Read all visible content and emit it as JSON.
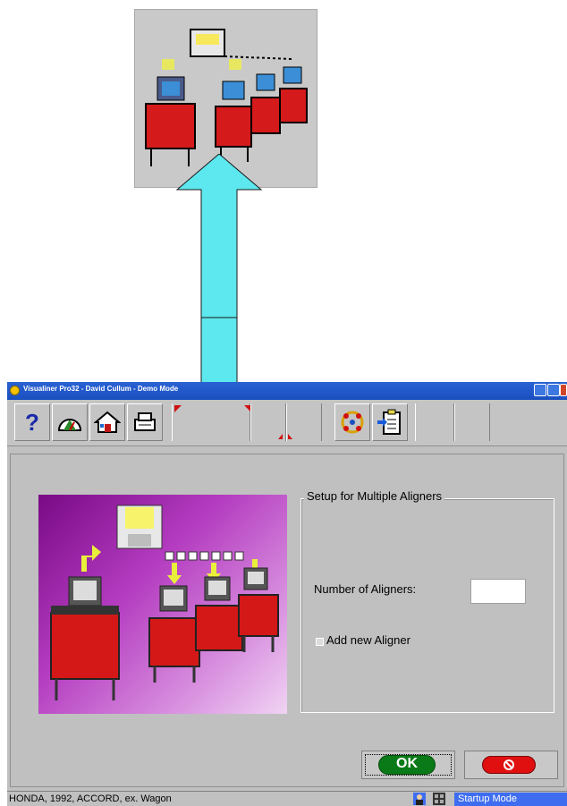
{
  "window": {
    "title": "Visualiner Pro32 - David Cullum - Demo Mode"
  },
  "toolbar": {
    "buttons": [
      {
        "icon": "help-icon",
        "glyph": "?"
      },
      {
        "icon": "gauge-icon"
      },
      {
        "icon": "home-icon"
      },
      {
        "icon": "printer-icon"
      },
      {
        "icon": "network-icon"
      },
      {
        "icon": "clipboard-icon"
      }
    ]
  },
  "group": {
    "title": "Setup for Multiple Aligners",
    "number_label": "Number of Aligners:",
    "number_value": "",
    "add_label": "Add new Aligner",
    "add_checked": false
  },
  "buttons": {
    "ok_label": "OK"
  },
  "status": {
    "vehicle": "HONDA, 1992, ACCORD, ex. Wagon",
    "mode": "Startup Mode"
  },
  "colors": {
    "arrow": "#5de7ee",
    "ok": "#0a7a18",
    "cancel": "#e01010",
    "titlebar": "#1a4fbf"
  }
}
